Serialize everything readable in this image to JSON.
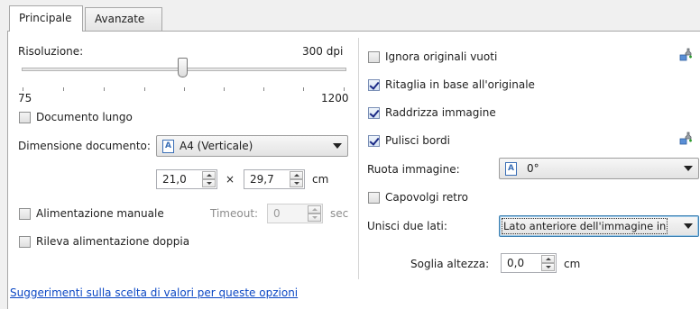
{
  "tabs": [
    {
      "label": "Principale",
      "active": true
    },
    {
      "label": "Avanzate",
      "active": false
    }
  ],
  "left": {
    "resolution": {
      "label": "Risoluzione:",
      "value_label": "300 dpi",
      "min_label": "75",
      "max_label": "1200",
      "value": 300,
      "min": 75,
      "max": 1200
    },
    "long_document": {
      "label": "Documento lungo",
      "checked": false
    },
    "document_size": {
      "label": "Dimensione documento:",
      "selected": "A4 (Verticale)",
      "width": "21,0",
      "times": "×",
      "height": "29,7",
      "unit": "cm"
    },
    "manual_feed": {
      "label": "Alimentazione manuale",
      "checked": false
    },
    "timeout": {
      "label": "Timeout:",
      "value": "0",
      "unit": "sec",
      "enabled": false
    },
    "double_feed": {
      "label": "Rileva alimentazione doppia",
      "checked": false
    },
    "help_link": "Suggerimenti sulla scelta di valori per queste opzioni"
  },
  "right": {
    "ignore_blank": {
      "label": "Ignora originali vuoti",
      "checked": false
    },
    "crop_to_original": {
      "label": "Ritaglia in base all'originale",
      "checked": true
    },
    "straighten": {
      "label": "Raddrizza immagine",
      "checked": true
    },
    "clean_borders": {
      "label": "Pulisci bordi",
      "checked": true
    },
    "rotate": {
      "label": "Ruota immagine:",
      "selected": "0°"
    },
    "flip_back": {
      "label": "Capovolgi retro",
      "checked": false
    },
    "merge_sides": {
      "label": "Unisci due lati:",
      "selected": "Lato anteriore dell'immagine in"
    },
    "height_threshold": {
      "label": "Soglia altezza:",
      "value": "0,0",
      "unit": "cm"
    }
  },
  "colors": {
    "link": "#0b47c4",
    "check": "#1b2a86",
    "panel": "#ffffff",
    "window": "#f0f0f0"
  }
}
